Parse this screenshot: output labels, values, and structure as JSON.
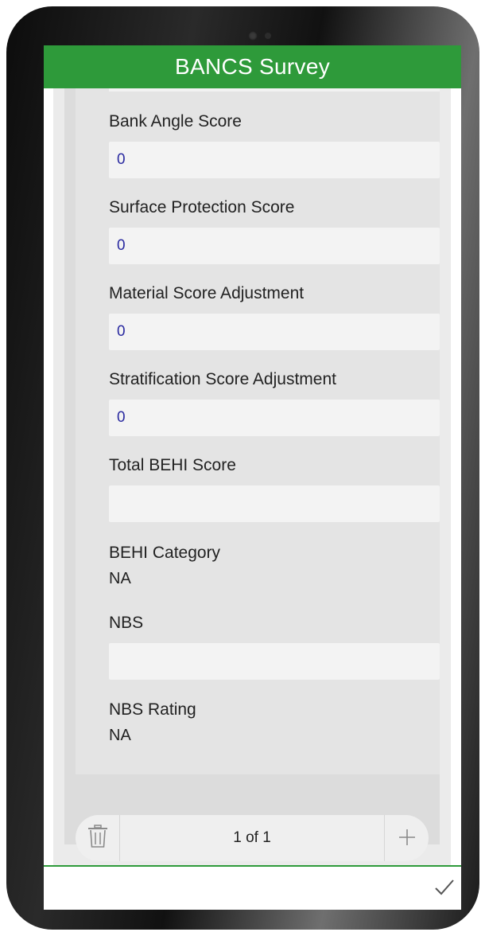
{
  "app": {
    "title": "BANCS Survey"
  },
  "fields": [
    {
      "label": "Bank Angle Score",
      "value": "0"
    },
    {
      "label": "Surface Protection Score",
      "value": "0"
    },
    {
      "label": "Material Score Adjustment",
      "value": "0"
    },
    {
      "label": "Stratification Score Adjustment",
      "value": "0"
    },
    {
      "label": "Total BEHI Score",
      "value": ""
    }
  ],
  "behi_category": {
    "label": "BEHI Category",
    "value": "NA"
  },
  "nbs": {
    "label": "NBS",
    "value": ""
  },
  "nbs_rating": {
    "label": "NBS Rating",
    "value": "NA"
  },
  "pager": {
    "text": "1 of 1"
  },
  "icons": {
    "trash": "trash-icon",
    "add": "plus-icon",
    "submit": "checkmark-icon"
  },
  "colors": {
    "accent": "#2e9a3a"
  }
}
